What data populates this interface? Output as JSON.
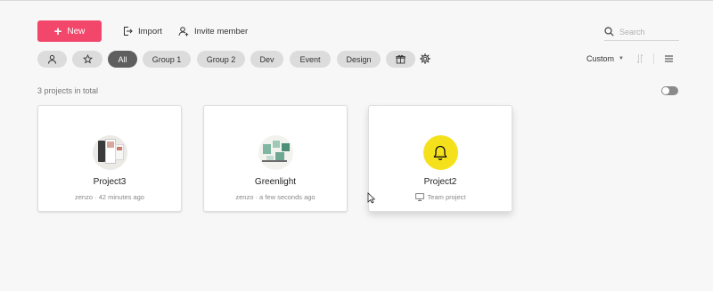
{
  "toolbar": {
    "new_label": "New",
    "import_label": "Import",
    "invite_label": "Invite member",
    "search_placeholder": "Search"
  },
  "filters": {
    "chips": [
      "All",
      "Group 1",
      "Group 2",
      "Dev",
      "Event",
      "Design"
    ],
    "active": "All",
    "icons": [
      "person-icon",
      "star-icon",
      "gift-icon",
      "gear-icon"
    ]
  },
  "sort": {
    "label": "Custom"
  },
  "summary": {
    "count_text": "3 projects in total"
  },
  "projects": [
    {
      "title": "Project3",
      "meta": "zenzo · 42 minutes ago",
      "thumb": "image-thumbnail"
    },
    {
      "title": "Greenlight",
      "meta": "zenzo · a few seconds ago",
      "thumb": "image-thumbnail"
    },
    {
      "title": "Project2",
      "meta": "Team project",
      "thumb": "bell-icon",
      "thumb_color": "#f5e11b"
    }
  ],
  "colors": {
    "accent": "#f2466b",
    "active_chip": "#5f5f5f",
    "chip": "#dcdcdc"
  }
}
